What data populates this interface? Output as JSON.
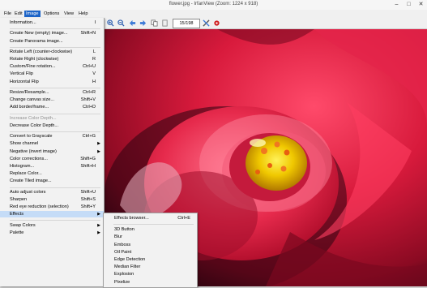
{
  "window": {
    "title": "flower.jpg - IrfanView (Zoom: 1224 x 918)"
  },
  "menubar": [
    "File",
    "Edit",
    "Image",
    "Options",
    "View",
    "Help"
  ],
  "toolbar": {
    "page_counter": "15/198"
  },
  "image_menu": {
    "items": [
      {
        "label": "Information...",
        "shortcut": "I"
      },
      {
        "sep": true
      },
      {
        "label": "Create New (empty) image...",
        "shortcut": "Shift+N"
      },
      {
        "label": "Create Panorama image...",
        "shortcut": ""
      },
      {
        "sep": true
      },
      {
        "label": "Rotate Left (counter-clockwise)",
        "shortcut": "L"
      },
      {
        "label": "Rotate Right (clockwise)",
        "shortcut": "R"
      },
      {
        "label": "Custom/Fine rotation...",
        "shortcut": "Ctrl+U"
      },
      {
        "label": "Vertical Flip",
        "shortcut": "V"
      },
      {
        "label": "Horizontal Flip",
        "shortcut": "H"
      },
      {
        "sep": true
      },
      {
        "label": "Resize/Resample...",
        "shortcut": "Ctrl+R"
      },
      {
        "label": "Change canvas size...",
        "shortcut": "Shift+V"
      },
      {
        "label": "Add border/frame...",
        "shortcut": "Ctrl+D"
      },
      {
        "sep": true
      },
      {
        "label": "Increase Color Depth...",
        "shortcut": "",
        "disabled": true
      },
      {
        "label": "Decrease Color Depth...",
        "shortcut": ""
      },
      {
        "sep": true
      },
      {
        "label": "Convert to Grayscale",
        "shortcut": "Ctrl+G"
      },
      {
        "label": "Show channel",
        "shortcut": "",
        "submenu": true
      },
      {
        "label": "Negative (invert image)",
        "shortcut": "",
        "submenu": true
      },
      {
        "label": "Color corrections...",
        "shortcut": "Shift+G"
      },
      {
        "label": "Histogram...",
        "shortcut": "Shift+H"
      },
      {
        "label": "Replace Color...",
        "shortcut": ""
      },
      {
        "label": "Create Tiled image...",
        "shortcut": ""
      },
      {
        "sep": true
      },
      {
        "label": "Auto adjust colors",
        "shortcut": "Shift+U"
      },
      {
        "label": "Sharpen",
        "shortcut": "Shift+S"
      },
      {
        "label": "Red eye reduction (selection)",
        "shortcut": "Shift+Y"
      },
      {
        "label": "Effects",
        "shortcut": "",
        "submenu": true,
        "highlighted": true
      },
      {
        "sep": true
      },
      {
        "label": "Swap Colors",
        "shortcut": "",
        "submenu": true
      },
      {
        "label": "Palette",
        "shortcut": "",
        "submenu": true
      }
    ]
  },
  "effects_submenu": {
    "items": [
      {
        "label": "Effects browser...",
        "shortcut": "Ctrl+E"
      },
      {
        "sep": true
      },
      {
        "label": "3D Button",
        "shortcut": ""
      },
      {
        "label": "Blur",
        "shortcut": ""
      },
      {
        "label": "Emboss",
        "shortcut": ""
      },
      {
        "label": "Oil Paint",
        "shortcut": ""
      },
      {
        "label": "Edge Detection",
        "shortcut": ""
      },
      {
        "label": "Median Filter",
        "shortcut": ""
      },
      {
        "label": "Explosion",
        "shortcut": ""
      },
      {
        "label": "Pixelize",
        "shortcut": ""
      }
    ]
  },
  "colors": {
    "menu_highlight": "#c5dcf7",
    "menubar_active": "#1c64c8",
    "flower": "#d8163a"
  }
}
